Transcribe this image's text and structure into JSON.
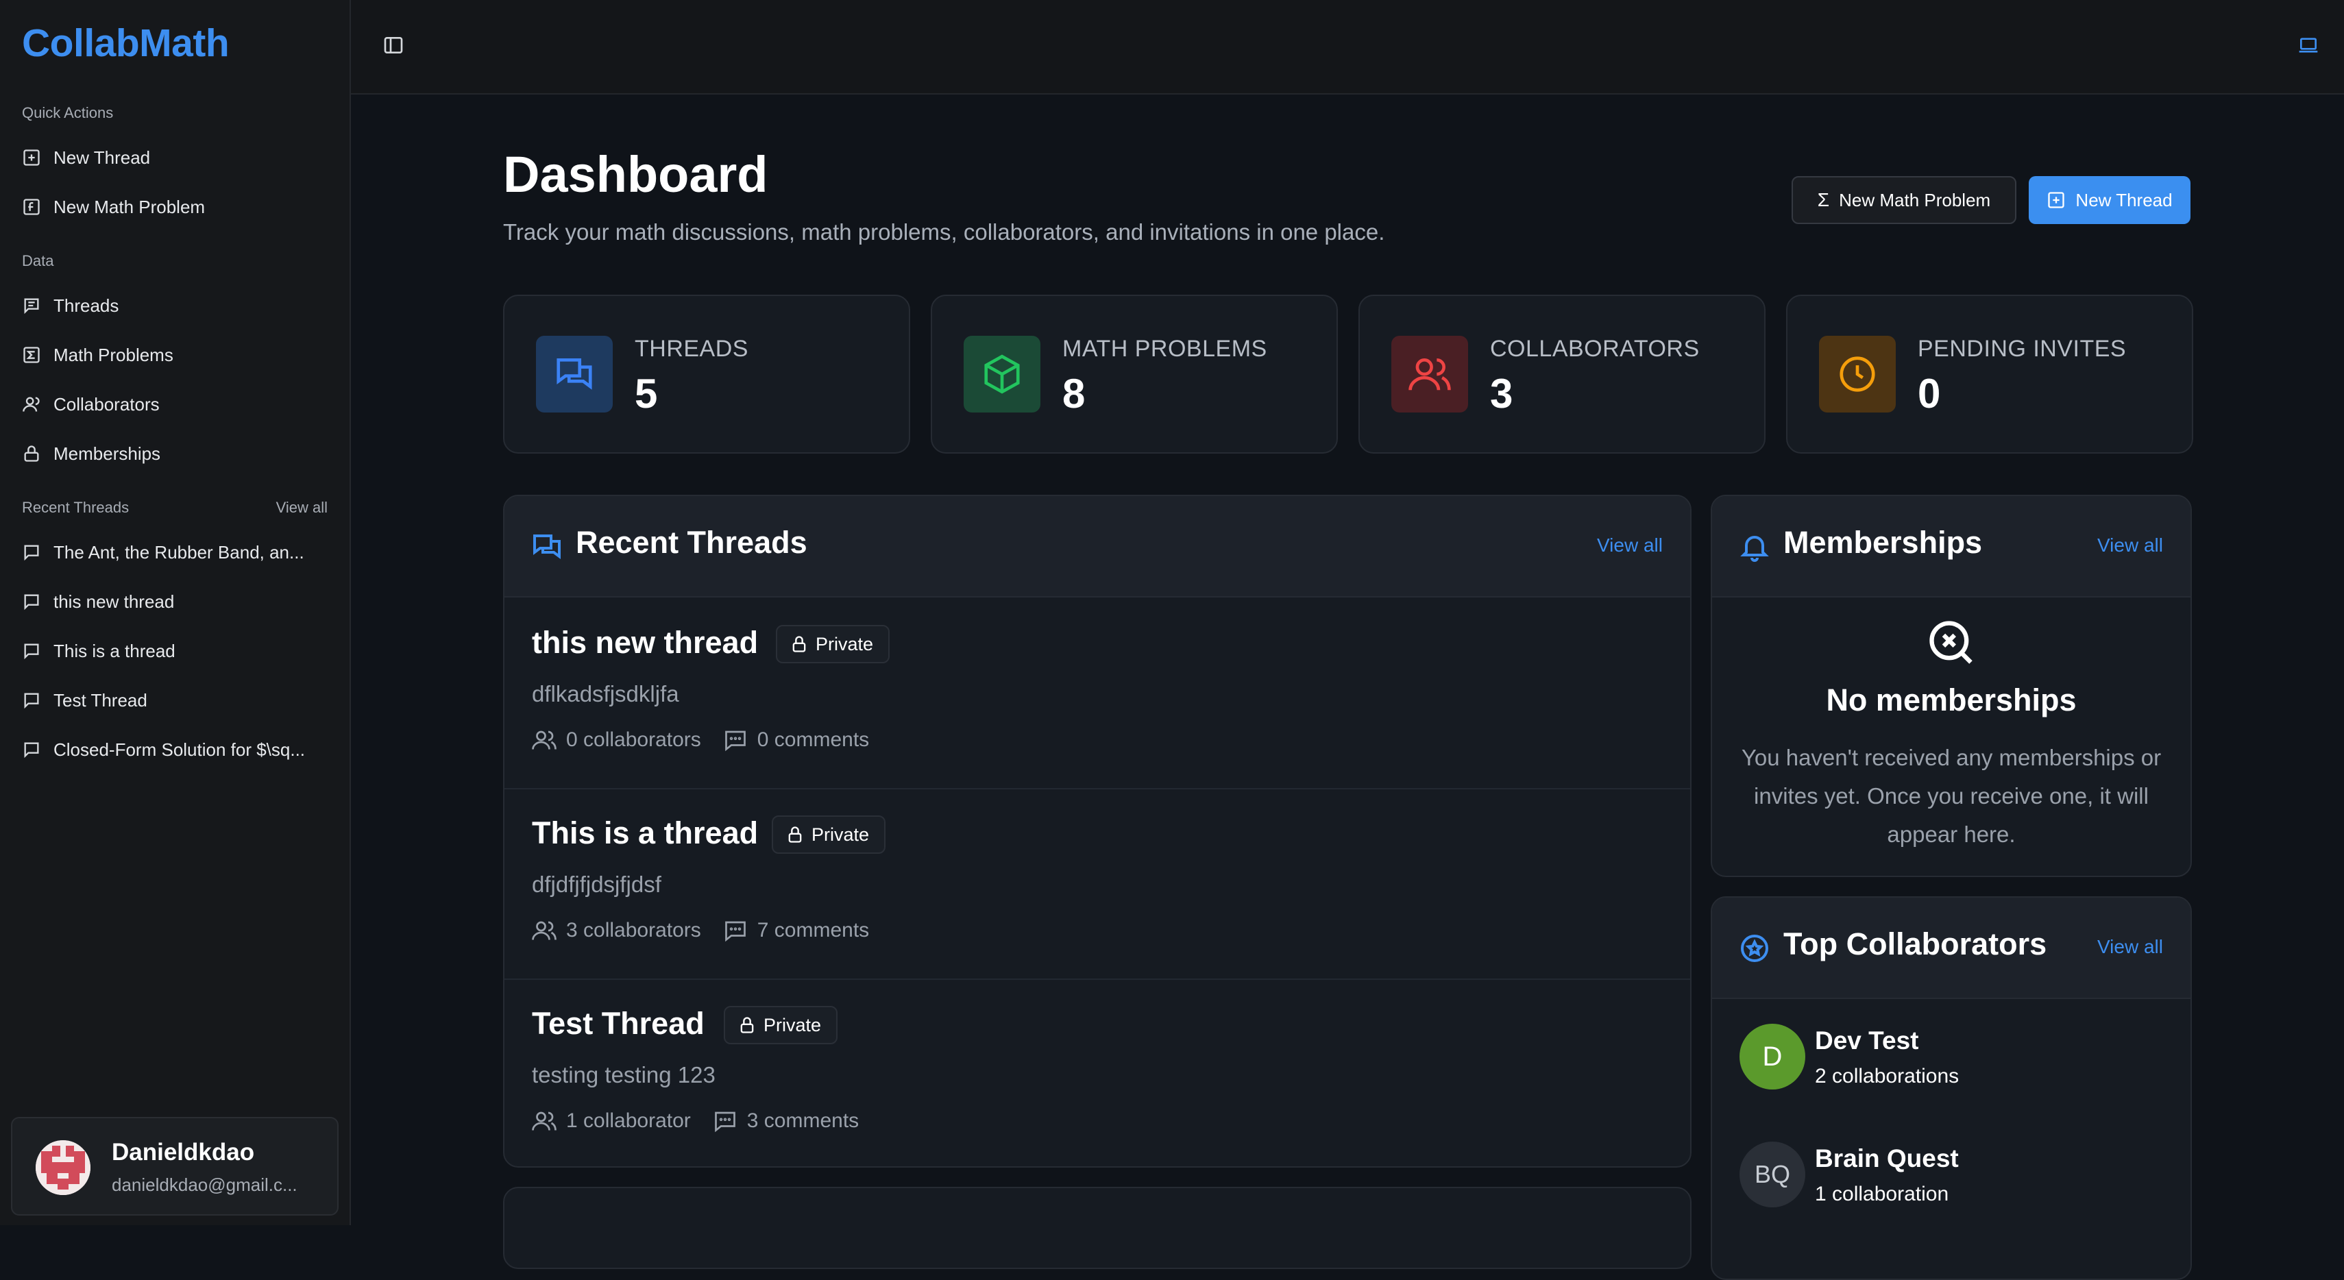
{
  "app": {
    "name": "CollabMath"
  },
  "sidebar": {
    "quick_actions_label": "Quick Actions",
    "quick_actions": [
      {
        "label": "New Thread",
        "icon": "message-plus-icon"
      },
      {
        "label": "New Math Problem",
        "icon": "function-icon"
      }
    ],
    "data_label": "Data",
    "data_items": [
      {
        "label": "Threads",
        "icon": "message-lines-icon"
      },
      {
        "label": "Math Problems",
        "icon": "sigma-square-icon"
      },
      {
        "label": "Collaborators",
        "icon": "user-icon"
      },
      {
        "label": "Memberships",
        "icon": "lock-icon"
      }
    ],
    "recent_label": "Recent Threads",
    "recent_view_all": "View all",
    "recent_threads": [
      "The Ant, the Rubber Band, an...",
      "this new thread",
      "This is a thread",
      "Test Thread",
      "Closed-Form Solution for $\\sq..."
    ],
    "user": {
      "name": "Danieldkdao",
      "email": "danieldkdao@gmail.c..."
    }
  },
  "header": {
    "title": "Dashboard",
    "subtitle": "Track your math discussions, math problems, collaborators, and invitations in one place.",
    "new_math_problem_label": "New Math Problem",
    "new_thread_label": "New Thread"
  },
  "stats": [
    {
      "label": "THREADS",
      "value": "5",
      "color": "#3b82f6",
      "icon": "messages-icon"
    },
    {
      "label": "MATH PROBLEMS",
      "value": "8",
      "color": "#22c55e",
      "icon": "cube-icon"
    },
    {
      "label": "COLLABORATORS",
      "value": "3",
      "color": "#ef4444",
      "icon": "users-icon"
    },
    {
      "label": "PENDING INVITES",
      "value": "0",
      "color": "#f59e0b",
      "icon": "clock-icon"
    }
  ],
  "recent_threads_panel": {
    "title": "Recent Threads",
    "view_all": "View all",
    "threads": [
      {
        "title": "this new thread",
        "visibility": "Private",
        "description": "dflkadsfjsdkljfa",
        "collaborators": "0 collaborators",
        "comments": "0 comments"
      },
      {
        "title": "This is a thread",
        "visibility": "Private",
        "description": "dfjdfjfjdsjfjdsf",
        "collaborators": "3 collaborators",
        "comments": "7 comments"
      },
      {
        "title": "Test Thread",
        "visibility": "Private",
        "description": "testing testing 123",
        "collaborators": "1 collaborator",
        "comments": "3 comments"
      }
    ]
  },
  "memberships_panel": {
    "title": "Memberships",
    "view_all": "View all",
    "empty_title": "No memberships",
    "empty_text": "You haven't received any memberships or invites yet. Once you receive one, it will appear here."
  },
  "top_collaborators_panel": {
    "title": "Top Collaborators",
    "view_all": "View all",
    "collaborators": [
      {
        "initials": "D",
        "name": "Dev Test",
        "count": "2 collaborations",
        "color": "#5b9a2c"
      },
      {
        "initials": "BQ",
        "name": "Brain Quest",
        "count": "1 collaboration",
        "color": "#2a2f37"
      }
    ]
  }
}
